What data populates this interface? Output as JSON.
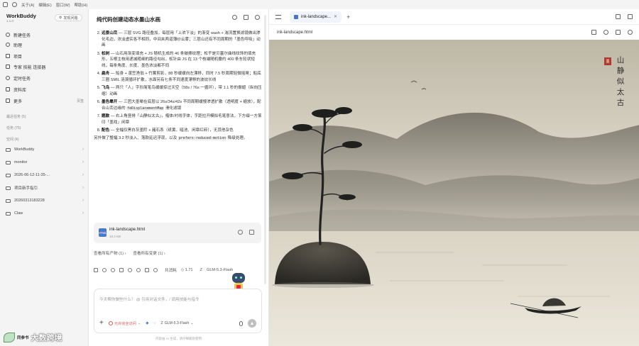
{
  "menubar": {
    "items": [
      "关于(A)",
      "编辑(E)",
      "窗口(W)",
      "帮助(H)"
    ]
  },
  "sidebar": {
    "app_name": "WorkBuddy",
    "version": "1.1.0",
    "feedback_label": "发现问题",
    "nav": [
      {
        "label": "新建任务",
        "icon": "plus-circle-icon"
      },
      {
        "label": "助理",
        "icon": "assistant-icon"
      },
      {
        "label": "项目",
        "icon": "project-icon"
      },
      {
        "label": "专家 技能 连接器",
        "icon": "expert-icon"
      },
      {
        "label": "定时任务",
        "icon": "clock-icon"
      },
      {
        "label": "资料库",
        "icon": "library-icon"
      },
      {
        "label": "更多",
        "icon": "more-icon",
        "right": "页签"
      }
    ],
    "section_recent": "最近任务 (5)",
    "section_tasks": "任务 (75)",
    "section_space": "空间 (4)",
    "folders": [
      "WorkBuddy",
      "monitor",
      "2026-06-12-11-35-...",
      "项目新手指引",
      "20260313183228",
      "Claw"
    ],
    "logo_text": "大数跨境",
    "logo_small": "同参书"
  },
  "chat": {
    "title": "纯代码创建动态水墨山水画",
    "items": [
      {
        "head": "远景山峦",
        "text": " — 三层 SVG 路径叠加，每层用「上浓下淡」的渐变 wash + 湍流置换滤镜做出渗化毛边，浓淡虚实各不相同，中间夹两道薄纱云雾；三层山还有不同周期的「墨色呼吸」动画"
      },
      {
        "head": "松树",
        "text": " — 山石用渐变填充 + JS 随机生成的 46 条皴擦纹理；松干是贝塞尔曲线纹饰的填充形，五根主枝用递减粗细的路径勾出，松针由 JS 在 13 个枝端随机撒约 400 条车轮状短线，每条角度、长度、墨色浓淡都不同"
      },
      {
        "head": "扁舟",
        "text": " — 船身 + 蓬笠渔翁 + 竹篙剪影，88 秒缓缓向左漂移，同时 7.5 秒周期轻微摇晃；船底三圈 SMIL 涟漪循环扩散，水面另有七条不同速度漂移的波纹长线"
      },
      {
        "head": "飞鸟",
        "text": " — 两只「人」字形简笔鸟缓缓掠过天空（58s / 76s 一循环），带 1.1 秒的振翅（纵向压缩）动画"
      },
      {
        "head": "墨色晕开",
        "text": " — 三团大墨晕在底层以 26s/34s/42s 不同周期缓慢渗透扩散（透明度 + 缩放），配合山峦边缘的 ",
        "code": "feDisplacementMap",
        "tail": " 滑化滤镜"
      },
      {
        "head": "题款",
        "text": " — 右上角竖排「山静似太古」，楷体/衬线字体，字距拉开模拟毛笔意法，下方缀一方篆印「墨戏」闲章"
      },
      {
        "head": "配色",
        "text": " — 全幅仅黑白灰墨阶 + 赭石系（纸黄、暗池、闲章红砖），无其他杂色"
      }
    ],
    "outro_a": "另外做了整幅 3.2 秒淡入、落款延迟浮现，以及 ",
    "outro_code": "prefers-reduced-motion",
    "outro_b": " 降级处理。",
    "file_name": "ink-landscape.html",
    "file_size": "18.2 KB",
    "file_icon": "HTML",
    "link_outputs": "查看所有产物 (1) ›",
    "link_changes": "查看所有变更 (1) ›",
    "cost_label": "共消耗",
    "cost_value": "◇ 1.71",
    "model_label": "GLM-5.3-Flash",
    "input_placeholder": "今天帮你做些什么？ @ 引用对话文件，/ 调用技能与指令",
    "permission_label": "允许完全访问",
    "model_select": "GLM-5.3-Flash",
    "footnote": "内容由 AI 生成，请仔细甄别使用"
  },
  "preview": {
    "tab_label": "ink-landscape...",
    "path": "ink-landscape.html",
    "poem": [
      "山",
      "静",
      "似",
      "太",
      "古"
    ],
    "seal": "墨"
  }
}
